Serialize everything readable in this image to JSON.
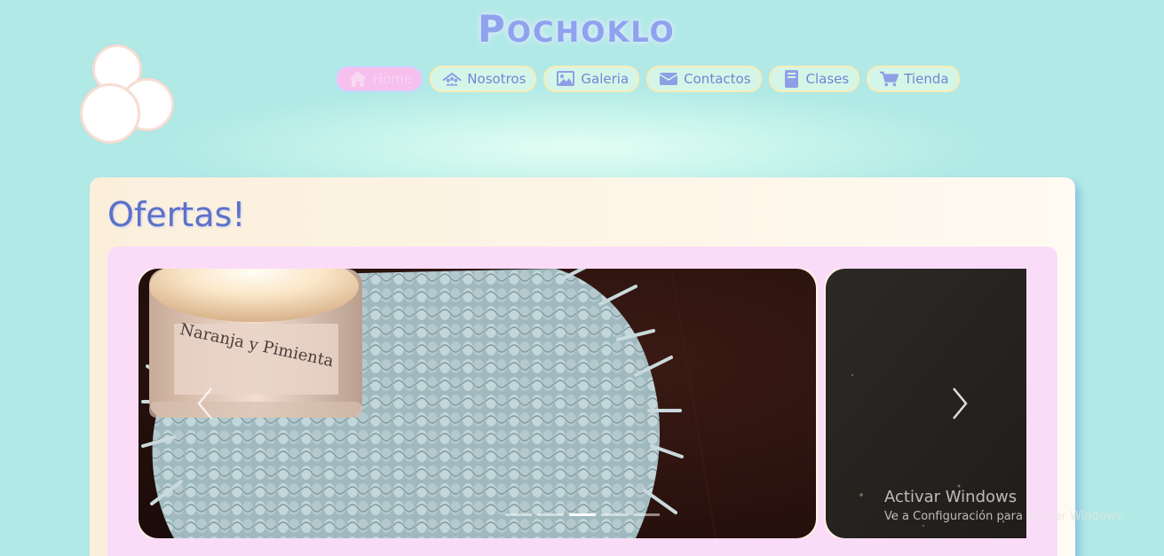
{
  "site": {
    "title_initial": "P",
    "title_rest": "OCHOKLO"
  },
  "nav": {
    "items": [
      {
        "label": "Home",
        "icon": "home-icon",
        "active": true
      },
      {
        "label": "Nosotros",
        "icon": "people-icon",
        "active": false
      },
      {
        "label": "Galeria",
        "icon": "image-icon",
        "active": false
      },
      {
        "label": "Contactos",
        "icon": "envelope-icon",
        "active": false
      },
      {
        "label": "Clases",
        "icon": "book-icon",
        "active": false
      },
      {
        "label": "Tienda",
        "icon": "cart-icon",
        "active": false
      }
    ]
  },
  "offers": {
    "title": "Ofertas!",
    "slides": [
      {
        "label": "Naranja y Pimienta",
        "label_line2": "",
        "kind": "candle-coaster"
      },
      {
        "label": "",
        "kind": "dark-fabric"
      }
    ],
    "indicator_count": 5,
    "active_indicator": 3
  },
  "watermark": {
    "title": "Activar Windows",
    "subtitle": "Ve a Configuración para activar Windows."
  },
  "colors": {
    "background": "#b0e9e6",
    "title": "#8fa2ee",
    "nav_bg": "#d4f6e8",
    "nav_active_bg": "#f6bfed",
    "nav_text": "#6f86d6",
    "card_bg": "#fbefdc",
    "offers_panel_bg": "#fbdcf8",
    "heading": "#5b71c9"
  }
}
